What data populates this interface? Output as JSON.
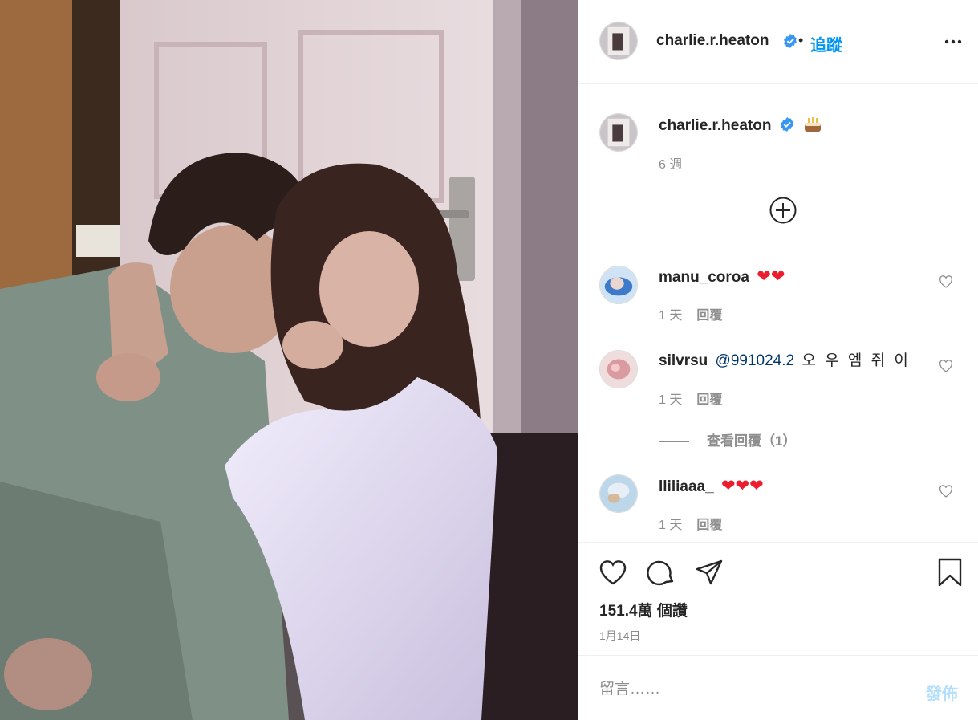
{
  "post": {
    "author": "charlie.r.heaton",
    "follow_label": "追蹤",
    "dot": "•",
    "caption_time": "6 週",
    "caption_emoji": "cake-emoji",
    "likes": "151.4萬 個讚",
    "date": "1月14日"
  },
  "comments": [
    {
      "user": "manu_coroa",
      "text": "❤❤",
      "time": "1 天",
      "reply": "回覆"
    },
    {
      "user": "silvrsu",
      "mention": "@991024.2",
      "text": "오 우 엠 쥐 이",
      "time": "1 天",
      "reply": "回覆",
      "view_replies": "查看回覆（1）"
    },
    {
      "user": "lliliaaa_",
      "text": "❤❤❤",
      "time": "1 天",
      "reply": "回覆"
    }
  ],
  "composer": {
    "placeholder": "留言……",
    "post_label": "發佈"
  },
  "colors": {
    "accent": "#0095f6",
    "heart": "#ed1c2e",
    "muted": "#8e8e8e"
  },
  "icons": [
    "verified-icon",
    "more-options-icon",
    "load-more-comments-icon",
    "like-icon",
    "comment-icon",
    "share-icon",
    "save-icon",
    "comment-like-icon"
  ]
}
